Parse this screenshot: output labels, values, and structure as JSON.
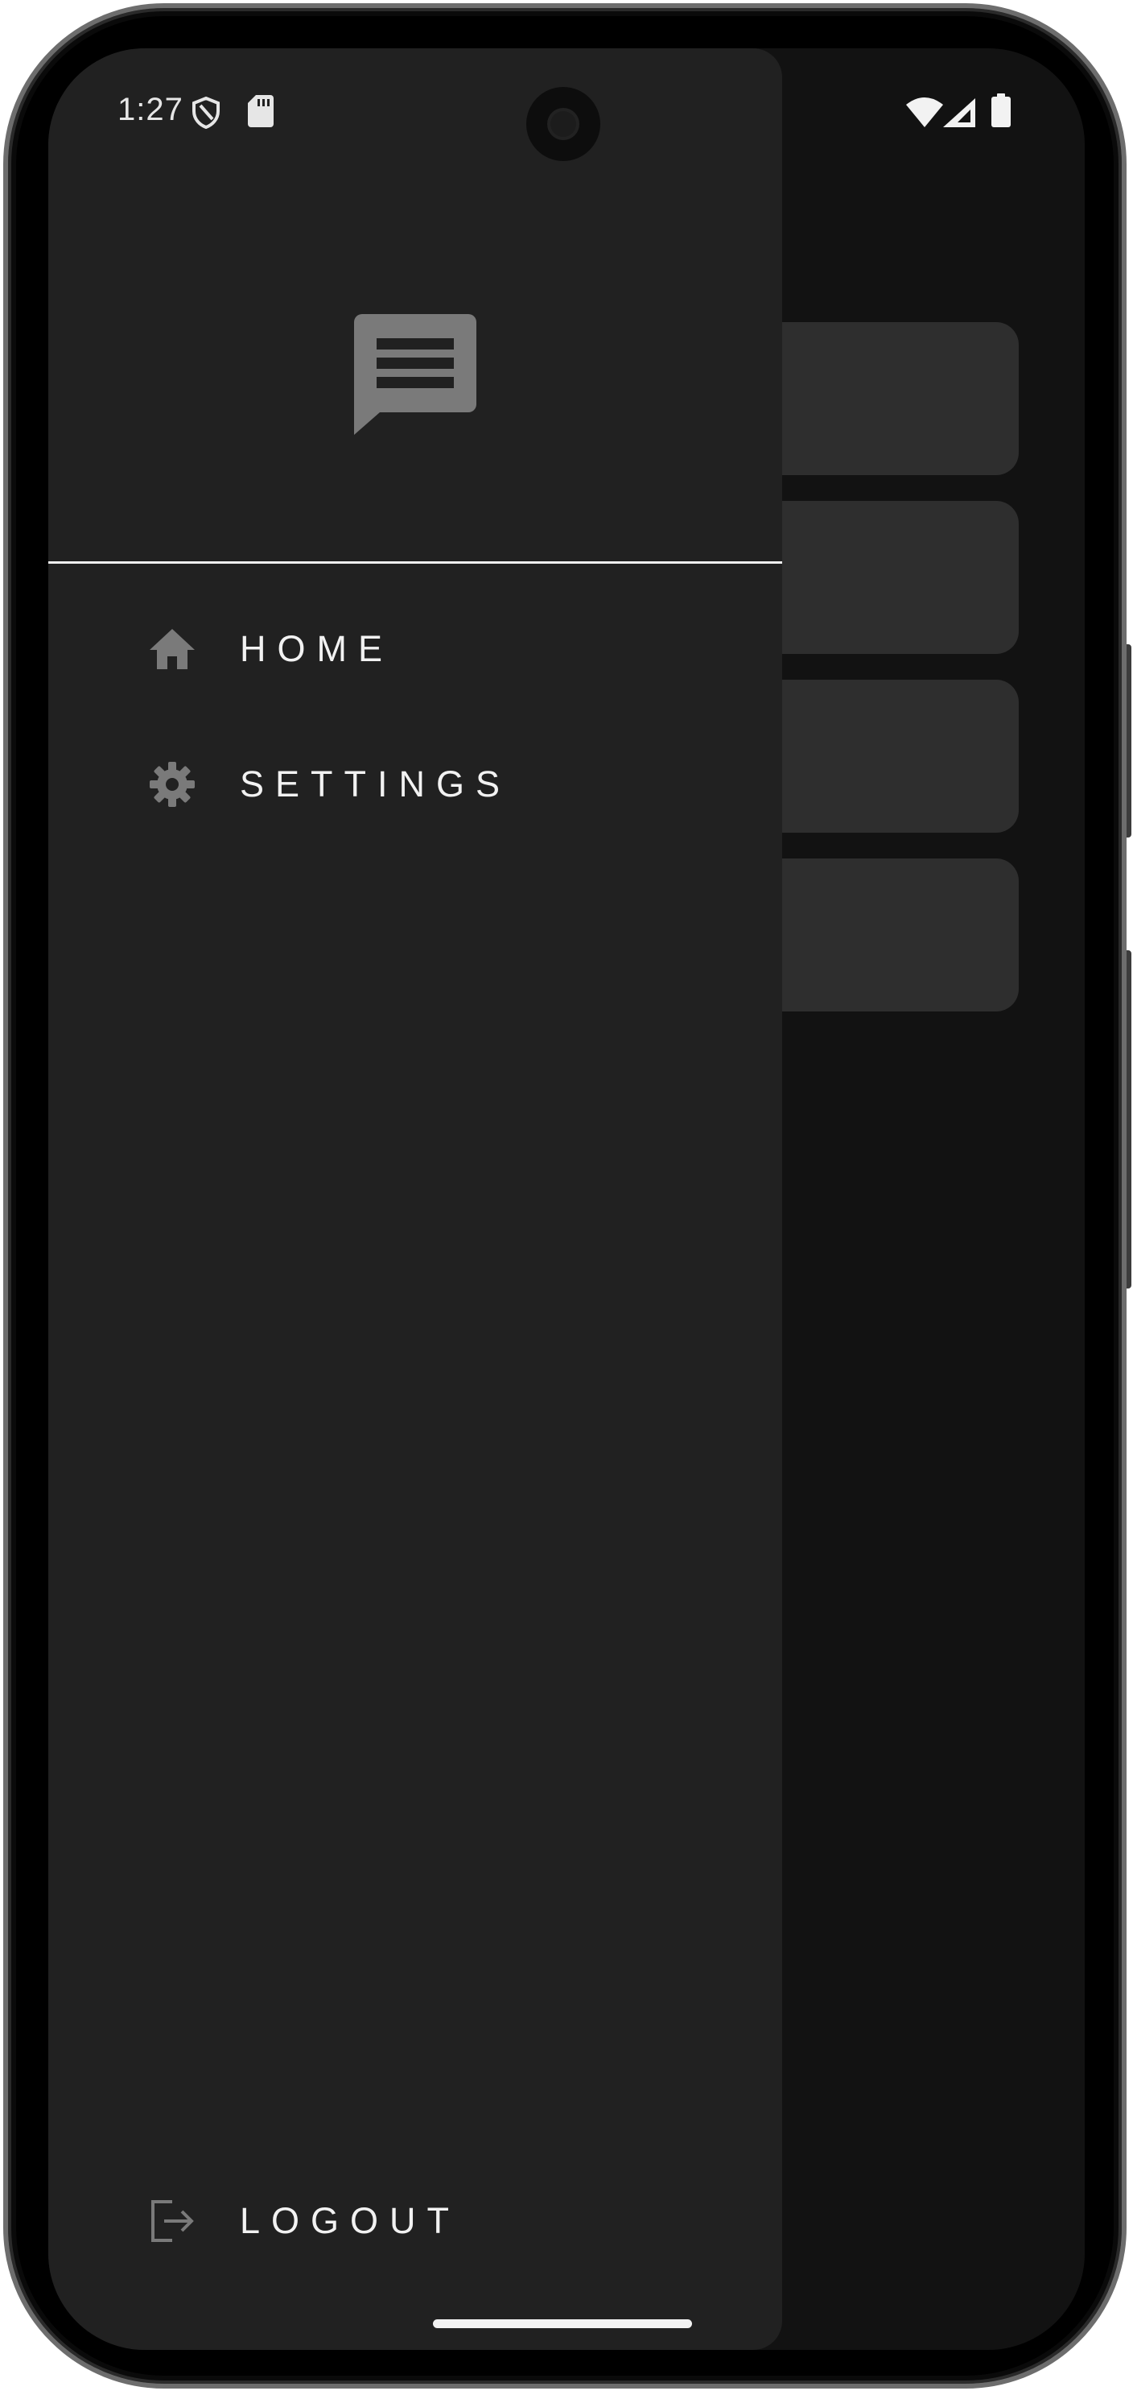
{
  "status_bar": {
    "time": "1:27"
  },
  "icons": {
    "shield": "shield-icon",
    "sd_card": "sd-card-icon",
    "wifi": "wifi-icon",
    "signal": "signal-icon",
    "battery": "battery-icon",
    "logo": "chat-message-icon",
    "home": "home-icon",
    "settings": "gear-icon",
    "logout": "logout-icon"
  },
  "drawer": {
    "items": [
      {
        "label": "HOME"
      },
      {
        "label": "SETTINGS"
      }
    ],
    "logout_label": "LOGOUT"
  },
  "colors": {
    "drawer_background": "#212121",
    "screen_background": "#121212",
    "card_background": "#2e2e2e",
    "icon_gray": "#7a7a7a",
    "text": "#f2f2f2"
  }
}
